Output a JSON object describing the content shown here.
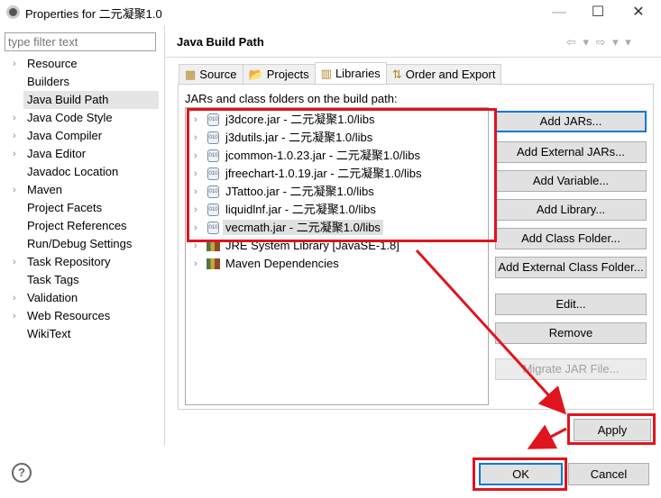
{
  "window": {
    "title": "Properties for 二元凝聚1.0",
    "minimize": "—",
    "maximize": "☐",
    "close": "✕"
  },
  "filter": {
    "placeholder": "type filter text"
  },
  "nav": [
    {
      "label": "Resource",
      "expandable": true
    },
    {
      "label": "Builders",
      "expandable": false
    },
    {
      "label": "Java Build Path",
      "expandable": false,
      "selected": true
    },
    {
      "label": "Java Code Style",
      "expandable": true
    },
    {
      "label": "Java Compiler",
      "expandable": true
    },
    {
      "label": "Java Editor",
      "expandable": true
    },
    {
      "label": "Javadoc Location",
      "expandable": false
    },
    {
      "label": "Maven",
      "expandable": true
    },
    {
      "label": "Project Facets",
      "expandable": false
    },
    {
      "label": "Project References",
      "expandable": false
    },
    {
      "label": "Run/Debug Settings",
      "expandable": false
    },
    {
      "label": "Task Repository",
      "expandable": true
    },
    {
      "label": "Task Tags",
      "expandable": false
    },
    {
      "label": "Validation",
      "expandable": true
    },
    {
      "label": "Web Resources",
      "expandable": true
    },
    {
      "label": "WikiText",
      "expandable": false
    }
  ],
  "header": {
    "title": "Java Build Path",
    "nav_icons": "⇦ ▾ ⇨ ▾ ▾"
  },
  "tabs": [
    {
      "label": "Source",
      "icon": "source-icon"
    },
    {
      "label": "Projects",
      "icon": "folder-icon"
    },
    {
      "label": "Libraries",
      "icon": "library-icon",
      "active": true
    },
    {
      "label": "Order and Export",
      "icon": "order-icon"
    }
  ],
  "libraries": {
    "label": "JARs and class folders on the build path:",
    "items": [
      {
        "label": "j3dcore.jar - 二元凝聚1.0/libs",
        "icon": "jar"
      },
      {
        "label": "j3dutils.jar - 二元凝聚1.0/libs",
        "icon": "jar"
      },
      {
        "label": "jcommon-1.0.23.jar - 二元凝聚1.0/libs",
        "icon": "jar"
      },
      {
        "label": "jfreechart-1.0.19.jar - 二元凝聚1.0/libs",
        "icon": "jar"
      },
      {
        "label": "JTattoo.jar - 二元凝聚1.0/libs",
        "icon": "jar"
      },
      {
        "label": "liquidlnf.jar - 二元凝聚1.0/libs",
        "icon": "jar"
      },
      {
        "label": "vecmath.jar - 二元凝聚1.0/libs",
        "icon": "jar",
        "selected": true
      },
      {
        "label": "JRE System Library [JavaSE-1.8]",
        "icon": "library"
      },
      {
        "label": "Maven Dependencies",
        "icon": "library"
      }
    ],
    "buttons": [
      {
        "label": "Add JARs...",
        "default": true
      },
      {
        "label": "Add External JARs..."
      },
      {
        "label": "Add Variable..."
      },
      {
        "label": "Add Library..."
      },
      {
        "label": "Add Class Folder..."
      },
      {
        "label": "Add External Class Folder..."
      },
      {
        "label": "Edit..."
      },
      {
        "label": "Remove"
      },
      {
        "label": "Migrate JAR File...",
        "disabled": true
      }
    ]
  },
  "footer": {
    "apply": "Apply",
    "ok": "OK",
    "cancel": "Cancel",
    "help": "?"
  },
  "annotation_color": "#e0141e"
}
